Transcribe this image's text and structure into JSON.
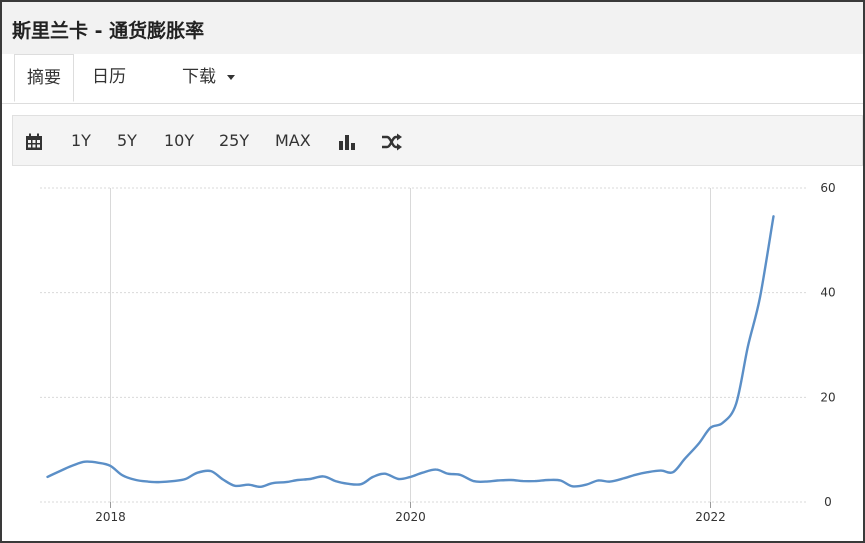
{
  "header": {
    "title": "斯里兰卡 - 通货膨胀率"
  },
  "tabs": [
    {
      "label": "摘要"
    },
    {
      "label": "日历"
    },
    {
      "label": "下载"
    }
  ],
  "toolbar": {
    "buttons": [
      {
        "label": "1Y"
      },
      {
        "label": "5Y"
      },
      {
        "label": "10Y"
      },
      {
        "label": "25Y"
      },
      {
        "label": "MAX"
      }
    ],
    "icons": [
      "calendar-icon",
      "bar-chart-icon",
      "shuffle-icon"
    ]
  },
  "colors": {
    "line": "#5b8fc7",
    "grid": "#d9d9d9",
    "axis_text": "#333333"
  },
  "chart_data": {
    "type": "line",
    "grid": true,
    "ylim": [
      0,
      60
    ],
    "y_ticks": [
      "0",
      "20",
      "40",
      "60"
    ],
    "x_ticks": [
      {
        "label": "2018",
        "x": 2018.0
      },
      {
        "label": "2020",
        "x": 2020.0
      },
      {
        "label": "2022",
        "x": 2022.0
      }
    ],
    "xlim": [
      2017.53,
      2022.65
    ],
    "series": [
      {
        "points": [
          [
            2017.58,
            4.8
          ],
          [
            2017.67,
            6.0
          ],
          [
            2017.75,
            7.0
          ],
          [
            2017.83,
            7.7
          ],
          [
            2017.92,
            7.5
          ],
          [
            2018.0,
            6.9
          ],
          [
            2018.08,
            5.1
          ],
          [
            2018.17,
            4.2
          ],
          [
            2018.25,
            3.9
          ],
          [
            2018.33,
            3.8
          ],
          [
            2018.42,
            4.0
          ],
          [
            2018.5,
            4.4
          ],
          [
            2018.58,
            5.6
          ],
          [
            2018.67,
            5.9
          ],
          [
            2018.75,
            4.3
          ],
          [
            2018.83,
            3.1
          ],
          [
            2018.92,
            3.3
          ],
          [
            2019.0,
            2.9
          ],
          [
            2019.08,
            3.6
          ],
          [
            2019.17,
            3.8
          ],
          [
            2019.25,
            4.2
          ],
          [
            2019.33,
            4.4
          ],
          [
            2019.42,
            4.9
          ],
          [
            2019.5,
            4.0
          ],
          [
            2019.58,
            3.5
          ],
          [
            2019.67,
            3.4
          ],
          [
            2019.75,
            4.8
          ],
          [
            2019.83,
            5.4
          ],
          [
            2019.92,
            4.4
          ],
          [
            2020.0,
            4.8
          ],
          [
            2020.08,
            5.6
          ],
          [
            2020.17,
            6.2
          ],
          [
            2020.25,
            5.4
          ],
          [
            2020.33,
            5.2
          ],
          [
            2020.42,
            4.0
          ],
          [
            2020.5,
            3.9
          ],
          [
            2020.58,
            4.1
          ],
          [
            2020.67,
            4.2
          ],
          [
            2020.75,
            4.0
          ],
          [
            2020.83,
            4.0
          ],
          [
            2020.92,
            4.2
          ],
          [
            2021.0,
            4.1
          ],
          [
            2021.08,
            3.0
          ],
          [
            2021.17,
            3.3
          ],
          [
            2021.25,
            4.1
          ],
          [
            2021.33,
            3.9
          ],
          [
            2021.42,
            4.5
          ],
          [
            2021.5,
            5.2
          ],
          [
            2021.58,
            5.7
          ],
          [
            2021.67,
            6.0
          ],
          [
            2021.75,
            5.7
          ],
          [
            2021.83,
            8.3
          ],
          [
            2021.92,
            11.1
          ],
          [
            2022.0,
            14.2
          ],
          [
            2022.08,
            15.1
          ],
          [
            2022.17,
            18.7
          ],
          [
            2022.25,
            29.8
          ],
          [
            2022.33,
            39.1
          ],
          [
            2022.42,
            54.6
          ]
        ]
      }
    ]
  }
}
